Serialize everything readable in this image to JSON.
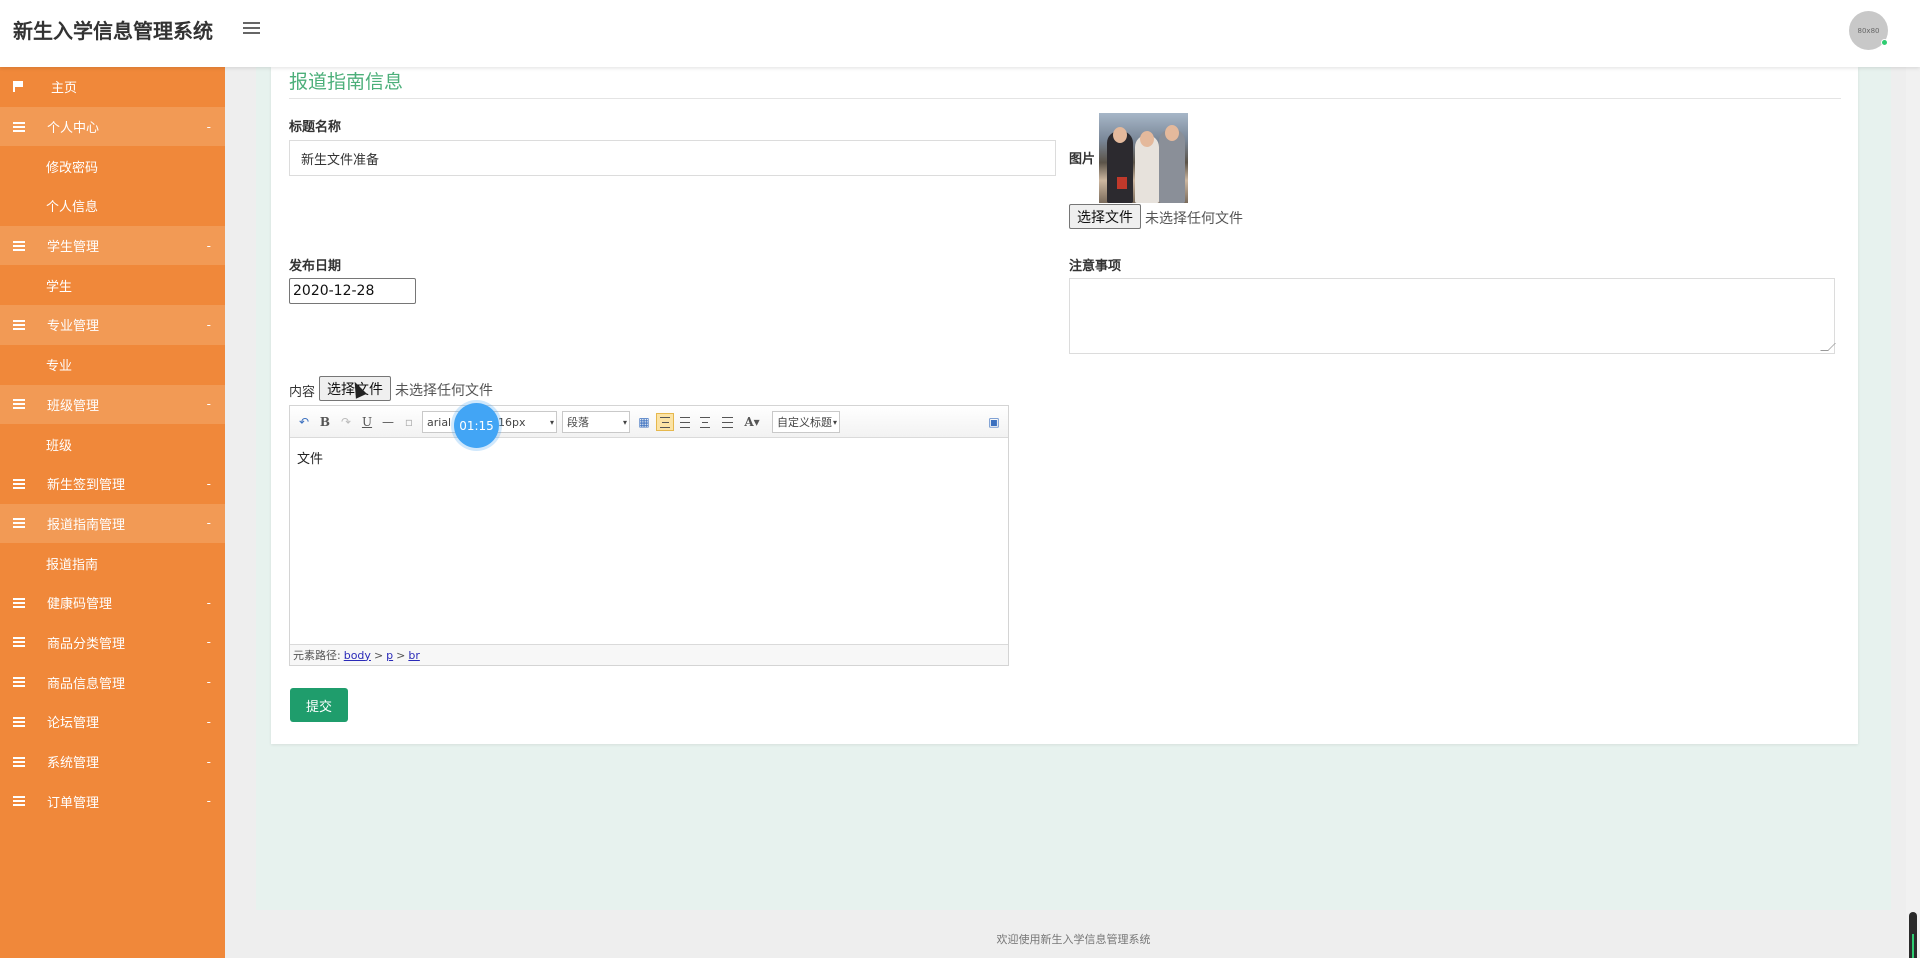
{
  "header": {
    "title": "新生入学信息管理系统",
    "avatar_text": "80x80"
  },
  "sidebar": {
    "items": [
      {
        "label": "主页",
        "type": "home"
      },
      {
        "label": "个人中心",
        "type": "group",
        "caret": "-"
      },
      {
        "label": "修改密码",
        "type": "sub"
      },
      {
        "label": "个人信息",
        "type": "sub"
      },
      {
        "label": "学生管理",
        "type": "group",
        "caret": "-"
      },
      {
        "label": "学生",
        "type": "sub"
      },
      {
        "label": "专业管理",
        "type": "group",
        "caret": "-"
      },
      {
        "label": "专业",
        "type": "sub"
      },
      {
        "label": "班级管理",
        "type": "group",
        "caret": "-"
      },
      {
        "label": "班级",
        "type": "sub"
      },
      {
        "label": "新生签到管理",
        "type": "group",
        "caret": "-"
      },
      {
        "label": "报道指南管理",
        "type": "group",
        "caret": "-"
      },
      {
        "label": "报道指南",
        "type": "sub"
      },
      {
        "label": "健康码管理",
        "type": "group",
        "caret": "-"
      },
      {
        "label": "商品分类管理",
        "type": "group",
        "caret": "-"
      },
      {
        "label": "商品信息管理",
        "type": "group",
        "caret": "-"
      },
      {
        "label": "论坛管理",
        "type": "group",
        "caret": "-"
      },
      {
        "label": "系统管理",
        "type": "group",
        "caret": "-"
      },
      {
        "label": "订单管理",
        "type": "group",
        "caret": "-"
      }
    ]
  },
  "form": {
    "page_title": "报道指南信息",
    "title_label": "标题名称",
    "title_value": "新生文件准备",
    "image_label": "图片",
    "file_button": "选择文件",
    "file_note": "未选择任何文件",
    "date_label": "发布日期",
    "date_value": "2020-12-28",
    "notes_label": "注意事项",
    "content_label": "内容",
    "content_file_button": "选择文件",
    "content_file_note": "未选择任何文件",
    "submit": "提交"
  },
  "editor": {
    "font_family": "arial",
    "font_size": "16px",
    "paragraph": "段落",
    "custom_title": "自定义标题",
    "body_text": "文件",
    "path_label": "元素路径:",
    "path": [
      "body",
      "p",
      "br"
    ]
  },
  "overlay": {
    "timer": "01:15"
  },
  "footer": {
    "text": "欢迎使用新生入学信息管理系统"
  }
}
